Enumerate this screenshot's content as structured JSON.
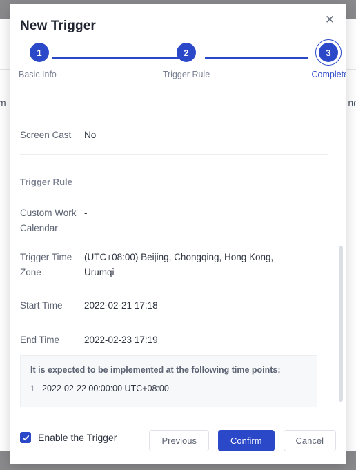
{
  "background": {
    "left_fragment": "m",
    "right_fragment": "nd"
  },
  "modal": {
    "title": "New Trigger",
    "close_label": "✕",
    "stepper": {
      "steps": [
        {
          "number": "1",
          "label": "Basic Info",
          "state": "done"
        },
        {
          "number": "2",
          "label": "Trigger Rule",
          "state": "done"
        },
        {
          "number": "3",
          "label": "Complete",
          "state": "current"
        }
      ]
    },
    "summary": {
      "screen_cast": {
        "label": "Screen Cast",
        "value": "No"
      }
    },
    "trigger_rule": {
      "section_title": "Trigger Rule",
      "fields": [
        {
          "label": "Custom Work Calendar",
          "value": "-"
        },
        {
          "label": "Trigger Time Zone",
          "value": "(UTC+08:00) Beijing, Chongqing, Hong Kong, Urumqi"
        },
        {
          "label": "Start Time",
          "value": "2022-02-21 17:18"
        },
        {
          "label": "End Time",
          "value": "2022-02-23 17:19"
        }
      ]
    },
    "info_box": {
      "title": "It is expected to be implemented at the following time points:",
      "items": [
        {
          "index": "1",
          "text": "2022-02-22 00:00:00 UTC+08:00"
        }
      ]
    },
    "footer": {
      "enable_checkbox": {
        "label": "Enable the Trigger",
        "checked": true
      },
      "buttons": [
        {
          "label": "Previous",
          "kind": "default"
        },
        {
          "label": "Confirm",
          "kind": "primary"
        },
        {
          "label": "Cancel",
          "kind": "default"
        }
      ]
    }
  },
  "colors": {
    "accent": "#2b48c8",
    "page_backdrop": "#8a8a8d",
    "text_primary": "#2e3440",
    "text_muted": "#7a8193",
    "info_box_bg": "#f7f8fa",
    "divider": "#ededf1"
  }
}
